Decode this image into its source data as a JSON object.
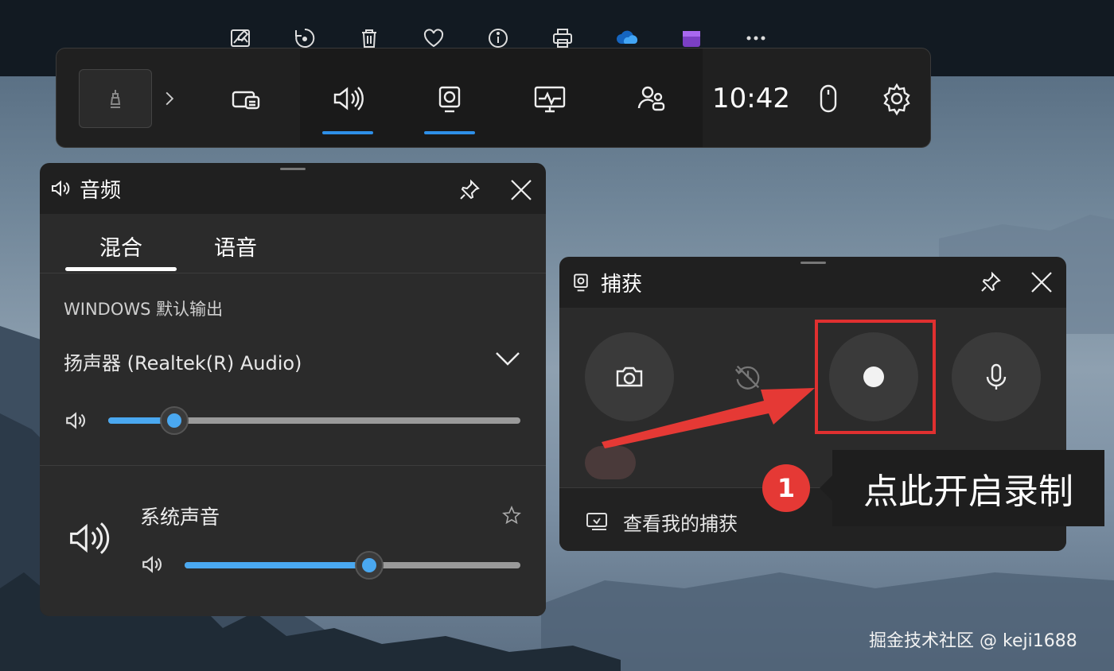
{
  "top_toolbar": {
    "icons": [
      "edit-image-icon",
      "rotate-icon",
      "trash-icon",
      "heart-icon",
      "info-icon",
      "print-icon",
      "onedrive-icon",
      "clipchamp-icon",
      "more-icon"
    ]
  },
  "game_bar": {
    "clock": "10:42",
    "icons": [
      "widget-menu-icon",
      "audio-icon",
      "capture-icon",
      "performance-icon",
      "social-icon",
      "mouse-icon",
      "settings-icon"
    ],
    "accent_color": "#2e8fe8"
  },
  "audio_panel": {
    "title": "音频",
    "tabs": [
      {
        "label": "混合",
        "active": true
      },
      {
        "label": "语音",
        "active": false
      }
    ],
    "section_label": "WINDOWS 默认输出",
    "output_device": "扬声器 (Realtek(R) Audio)",
    "master_volume": 0.16,
    "apps": [
      {
        "name": "系统声音",
        "volume": 0.55
      }
    ]
  },
  "capture_panel": {
    "title": "捕获",
    "buttons": [
      "screenshot-button",
      "record-last-button",
      "record-button",
      "microphone-button"
    ],
    "footer_link": "查看我的捕获"
  },
  "annotation": {
    "step": "1",
    "text": "点此开启录制",
    "color": "#e03030"
  },
  "watermark": "掘金技术社区 @ keji1688"
}
